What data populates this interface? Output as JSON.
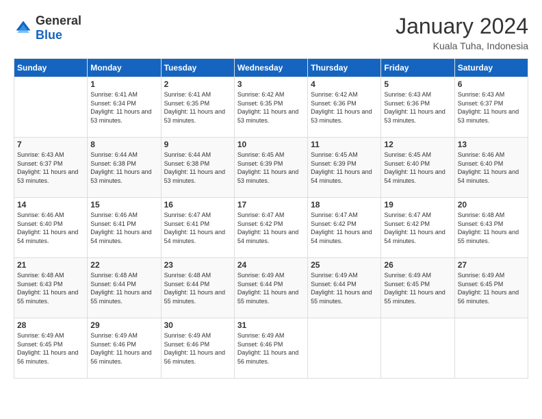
{
  "header": {
    "logo_general": "General",
    "logo_blue": "Blue",
    "month_year": "January 2024",
    "location": "Kuala Tuha, Indonesia"
  },
  "weekdays": [
    "Sunday",
    "Monday",
    "Tuesday",
    "Wednesday",
    "Thursday",
    "Friday",
    "Saturday"
  ],
  "weeks": [
    [
      {
        "day": "",
        "sunrise": "",
        "sunset": "",
        "daylight": ""
      },
      {
        "day": "1",
        "sunrise": "Sunrise: 6:41 AM",
        "sunset": "Sunset: 6:34 PM",
        "daylight": "Daylight: 11 hours and 53 minutes."
      },
      {
        "day": "2",
        "sunrise": "Sunrise: 6:41 AM",
        "sunset": "Sunset: 6:35 PM",
        "daylight": "Daylight: 11 hours and 53 minutes."
      },
      {
        "day": "3",
        "sunrise": "Sunrise: 6:42 AM",
        "sunset": "Sunset: 6:35 PM",
        "daylight": "Daylight: 11 hours and 53 minutes."
      },
      {
        "day": "4",
        "sunrise": "Sunrise: 6:42 AM",
        "sunset": "Sunset: 6:36 PM",
        "daylight": "Daylight: 11 hours and 53 minutes."
      },
      {
        "day": "5",
        "sunrise": "Sunrise: 6:43 AM",
        "sunset": "Sunset: 6:36 PM",
        "daylight": "Daylight: 11 hours and 53 minutes."
      },
      {
        "day": "6",
        "sunrise": "Sunrise: 6:43 AM",
        "sunset": "Sunset: 6:37 PM",
        "daylight": "Daylight: 11 hours and 53 minutes."
      }
    ],
    [
      {
        "day": "7",
        "sunrise": "Sunrise: 6:43 AM",
        "sunset": "Sunset: 6:37 PM",
        "daylight": "Daylight: 11 hours and 53 minutes."
      },
      {
        "day": "8",
        "sunrise": "Sunrise: 6:44 AM",
        "sunset": "Sunset: 6:38 PM",
        "daylight": "Daylight: 11 hours and 53 minutes."
      },
      {
        "day": "9",
        "sunrise": "Sunrise: 6:44 AM",
        "sunset": "Sunset: 6:38 PM",
        "daylight": "Daylight: 11 hours and 53 minutes."
      },
      {
        "day": "10",
        "sunrise": "Sunrise: 6:45 AM",
        "sunset": "Sunset: 6:39 PM",
        "daylight": "Daylight: 11 hours and 53 minutes."
      },
      {
        "day": "11",
        "sunrise": "Sunrise: 6:45 AM",
        "sunset": "Sunset: 6:39 PM",
        "daylight": "Daylight: 11 hours and 54 minutes."
      },
      {
        "day": "12",
        "sunrise": "Sunrise: 6:45 AM",
        "sunset": "Sunset: 6:40 PM",
        "daylight": "Daylight: 11 hours and 54 minutes."
      },
      {
        "day": "13",
        "sunrise": "Sunrise: 6:46 AM",
        "sunset": "Sunset: 6:40 PM",
        "daylight": "Daylight: 11 hours and 54 minutes."
      }
    ],
    [
      {
        "day": "14",
        "sunrise": "Sunrise: 6:46 AM",
        "sunset": "Sunset: 6:40 PM",
        "daylight": "Daylight: 11 hours and 54 minutes."
      },
      {
        "day": "15",
        "sunrise": "Sunrise: 6:46 AM",
        "sunset": "Sunset: 6:41 PM",
        "daylight": "Daylight: 11 hours and 54 minutes."
      },
      {
        "day": "16",
        "sunrise": "Sunrise: 6:47 AM",
        "sunset": "Sunset: 6:41 PM",
        "daylight": "Daylight: 11 hours and 54 minutes."
      },
      {
        "day": "17",
        "sunrise": "Sunrise: 6:47 AM",
        "sunset": "Sunset: 6:42 PM",
        "daylight": "Daylight: 11 hours and 54 minutes."
      },
      {
        "day": "18",
        "sunrise": "Sunrise: 6:47 AM",
        "sunset": "Sunset: 6:42 PM",
        "daylight": "Daylight: 11 hours and 54 minutes."
      },
      {
        "day": "19",
        "sunrise": "Sunrise: 6:47 AM",
        "sunset": "Sunset: 6:42 PM",
        "daylight": "Daylight: 11 hours and 54 minutes."
      },
      {
        "day": "20",
        "sunrise": "Sunrise: 6:48 AM",
        "sunset": "Sunset: 6:43 PM",
        "daylight": "Daylight: 11 hours and 55 minutes."
      }
    ],
    [
      {
        "day": "21",
        "sunrise": "Sunrise: 6:48 AM",
        "sunset": "Sunset: 6:43 PM",
        "daylight": "Daylight: 11 hours and 55 minutes."
      },
      {
        "day": "22",
        "sunrise": "Sunrise: 6:48 AM",
        "sunset": "Sunset: 6:44 PM",
        "daylight": "Daylight: 11 hours and 55 minutes."
      },
      {
        "day": "23",
        "sunrise": "Sunrise: 6:48 AM",
        "sunset": "Sunset: 6:44 PM",
        "daylight": "Daylight: 11 hours and 55 minutes."
      },
      {
        "day": "24",
        "sunrise": "Sunrise: 6:49 AM",
        "sunset": "Sunset: 6:44 PM",
        "daylight": "Daylight: 11 hours and 55 minutes."
      },
      {
        "day": "25",
        "sunrise": "Sunrise: 6:49 AM",
        "sunset": "Sunset: 6:44 PM",
        "daylight": "Daylight: 11 hours and 55 minutes."
      },
      {
        "day": "26",
        "sunrise": "Sunrise: 6:49 AM",
        "sunset": "Sunset: 6:45 PM",
        "daylight": "Daylight: 11 hours and 55 minutes."
      },
      {
        "day": "27",
        "sunrise": "Sunrise: 6:49 AM",
        "sunset": "Sunset: 6:45 PM",
        "daylight": "Daylight: 11 hours and 56 minutes."
      }
    ],
    [
      {
        "day": "28",
        "sunrise": "Sunrise: 6:49 AM",
        "sunset": "Sunset: 6:45 PM",
        "daylight": "Daylight: 11 hours and 56 minutes."
      },
      {
        "day": "29",
        "sunrise": "Sunrise: 6:49 AM",
        "sunset": "Sunset: 6:46 PM",
        "daylight": "Daylight: 11 hours and 56 minutes."
      },
      {
        "day": "30",
        "sunrise": "Sunrise: 6:49 AM",
        "sunset": "Sunset: 6:46 PM",
        "daylight": "Daylight: 11 hours and 56 minutes."
      },
      {
        "day": "31",
        "sunrise": "Sunrise: 6:49 AM",
        "sunset": "Sunset: 6:46 PM",
        "daylight": "Daylight: 11 hours and 56 minutes."
      },
      {
        "day": "",
        "sunrise": "",
        "sunset": "",
        "daylight": ""
      },
      {
        "day": "",
        "sunrise": "",
        "sunset": "",
        "daylight": ""
      },
      {
        "day": "",
        "sunrise": "",
        "sunset": "",
        "daylight": ""
      }
    ]
  ]
}
